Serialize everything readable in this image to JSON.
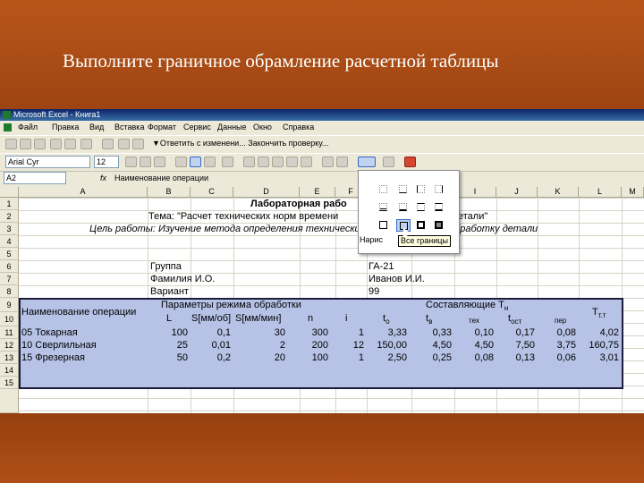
{
  "slide": {
    "title": "Выполните граничное обрамление расчетной таблицы"
  },
  "window": {
    "app_title": "Microsoft Excel",
    "doc_title": "Книга1"
  },
  "menu": [
    "Файл",
    "Правка",
    "Вид",
    "Вставка",
    "Формат",
    "Сервис",
    "Данные",
    "Окно",
    "Справка"
  ],
  "toolbar": {
    "reply_text": "▼Ответить с изменени... Закончить проверку...",
    "font_name": "Arial Cyr",
    "font_size": "12"
  },
  "formula_bar": {
    "name_box": "A2",
    "fx": "fx",
    "content": "Наименование операции"
  },
  "columns": [
    "A",
    "B",
    "C",
    "D",
    "E",
    "F",
    "G",
    "H",
    "I",
    "J",
    "K",
    "L",
    "M"
  ],
  "rows": [
    "1",
    "2",
    "3",
    "4",
    "5",
    "6",
    "7",
    "8",
    "9",
    "10",
    "11",
    "12",
    "13",
    "14",
    "15"
  ],
  "sheet": {
    "r1": "Лабораторная рабо",
    "r2_left": "Тема: \"Расчет технических норм времени",
    "r2_right": "етали\"",
    "r3": "Цель работы: Изучение метода определения технических норм времени на обработку детали",
    "group_label": "Группа",
    "group_value": "ГА-21",
    "name_label": "Фамилия И.О.",
    "name_value": "Иванов И.И.",
    "variant_label": "Вариант",
    "variant_value": "99",
    "hdr_op": "Наименование операции",
    "hdr_params": "Параметры режима обработки",
    "hdr_comp": "Составляющие Т",
    "hdr_comp_sub": "н",
    "hdr_Tt": "Т",
    "hdr_Tt_sub": "т.т",
    "hdr_L": "L",
    "hdr_S1": "S[мм/об]",
    "hdr_S2": "S[мм/мин]",
    "hdr_n": "n",
    "hdr_i": "i",
    "hdr_to": "t",
    "hdr_to_sub": "о",
    "hdr_tv": "t",
    "hdr_tv_sub": "в",
    "hdr_tex": "тех",
    "hdr_tost": "t",
    "hdr_tost_sub": "ост",
    "hdr_per": "пер",
    "data_rows": [
      {
        "op": "05 Токарная",
        "L": "100",
        "S1": "0,1",
        "S2": "30",
        "n": "300",
        "i": "1",
        "to": "3,33",
        "tv": "0,33",
        "tex": "0,10",
        "tost": "0,17",
        "per": "0,08",
        "Tt": "4,02"
      },
      {
        "op": "10 Сверлильная",
        "L": "25",
        "S1": "0,01",
        "S2": "2",
        "n": "200",
        "i": "12",
        "to": "150,00",
        "tv": "4,50",
        "tex": "4,50",
        "tost": "7,50",
        "per": "3,75",
        "Tt": "160,75"
      },
      {
        "op": "15 Фрезерная",
        "L": "50",
        "S1": "0,2",
        "S2": "20",
        "n": "100",
        "i": "1",
        "to": "2,50",
        "tv": "0,25",
        "tex": "0,08",
        "tost": "0,13",
        "per": "0,06",
        "Tt": "3,01"
      }
    ]
  },
  "borders_popup": {
    "label_partial": "Нарис",
    "tooltip": "Все границы"
  }
}
